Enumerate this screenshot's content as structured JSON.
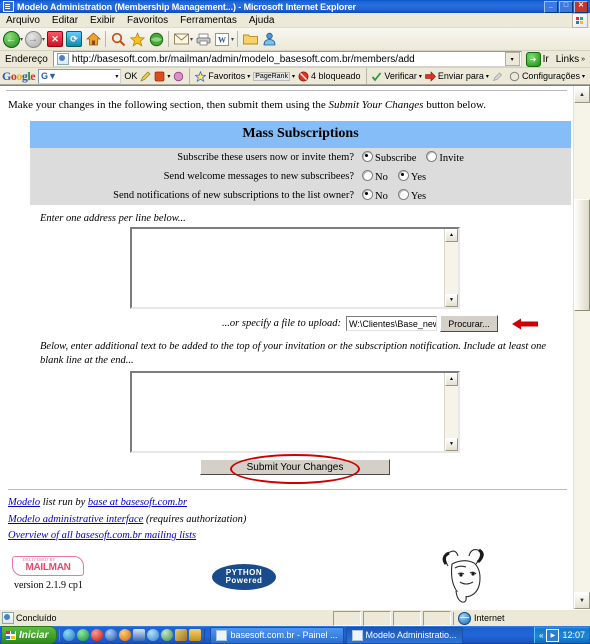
{
  "window": {
    "title": "Modelo Administration (Membership Management...) - Microsoft Internet Explorer",
    "minimize": "_",
    "maximize": "□",
    "close": "✕"
  },
  "menu": {
    "items": [
      "Arquivo",
      "Editar",
      "Exibir",
      "Favoritos",
      "Ferramentas",
      "Ajuda"
    ]
  },
  "toolbar": {
    "back": "Voltar",
    "forward": "Avançar",
    "stop": "Parar",
    "refresh": "Atualizar",
    "home": "Início",
    "search": "Pesquisar",
    "favorites": "Favoritos",
    "media": "Mídia",
    "history": "Histórico",
    "mail": "Email",
    "print": "Imprimir",
    "edit": "Editar",
    "folder": "Pasta",
    "messenger": "Messenger"
  },
  "address": {
    "label": "Endereço",
    "url": "http://basesoft.com.br/mailman/admin/modelo_basesoft.com.br/members/add",
    "go": "Ir",
    "links": "Links"
  },
  "googlebar": {
    "logo": [
      "G",
      "o",
      "o",
      "g",
      "l",
      "e"
    ],
    "search_value": "",
    "search_prefix": "G▼",
    "ok": "OK",
    "favorites": "Favoritos",
    "pagerank": "PageRank",
    "blocked": "4 bloqueado",
    "check": "Verificar",
    "sendto": "Enviar para",
    "settings": "Configurações"
  },
  "page": {
    "intro_before": "Make your changes in the following section, then submit them using the ",
    "intro_italic": "Submit Your Changes",
    "intro_after": " button below.",
    "section_title": "Mass Subscriptions",
    "options": [
      {
        "question": "Subscribe these users now or invite them?",
        "choices": [
          {
            "label": "Subscribe",
            "selected": true
          },
          {
            "label": "Invite",
            "selected": false
          }
        ]
      },
      {
        "question": "Send welcome messages to new subscribees?",
        "choices": [
          {
            "label": "No",
            "selected": false
          },
          {
            "label": "Yes",
            "selected": true
          }
        ]
      },
      {
        "question": "Send notifications of new subscriptions to the list owner?",
        "choices": [
          {
            "label": "No",
            "selected": true
          },
          {
            "label": "Yes",
            "selected": false
          }
        ]
      }
    ],
    "addresses_label": "Enter one address per line below...",
    "addresses_value": "",
    "upload_label": "...or specify a file to upload:",
    "upload_value": "W:\\Clientes\\Base_new\\tes",
    "upload_button": "Procurar...",
    "invitation_label": "Below, enter additional text to be added to the top of your invitation or the subscription notification. Include at least one blank line at the end...",
    "invitation_value": "",
    "submit_label": "Submit Your Changes",
    "footer_links": [
      {
        "link": "Modelo",
        "plain": " list run by ",
        "link2": "base at basesoft.com.br",
        "plain2": ""
      },
      {
        "link": "Modelo administrative interface",
        "plain": " (requires authorization)",
        "link2": "",
        "plain2": ""
      },
      {
        "link": "Overview of all basesoft.com.br mailing lists",
        "plain": "",
        "link2": "",
        "plain2": ""
      }
    ],
    "mailman_delivered": "DELIVERED BY",
    "mailman_logo": "MAILMAN",
    "mailman_version": "version 2.1.9 cp1",
    "python_line1": "PYTHON",
    "python_line2": "Powered",
    "gnu_alt": "GNU head"
  },
  "statusbar": {
    "text": "Concluído",
    "zone": "Internet"
  },
  "taskbar": {
    "start": "Iniciar",
    "tasks": [
      {
        "label": "basesoft.com.br - Painel ...",
        "active": false
      },
      {
        "label": "Modelo Administratio...",
        "active": true
      }
    ],
    "clock": "12:07",
    "chevron": "«"
  },
  "colors": {
    "section_header_bg": "#84bdf8",
    "row_bg": "#dcdcdc",
    "annotation_red": "#cc0000",
    "link_blue": "#0000cc",
    "titlebar_blue": "#1b66d8"
  }
}
